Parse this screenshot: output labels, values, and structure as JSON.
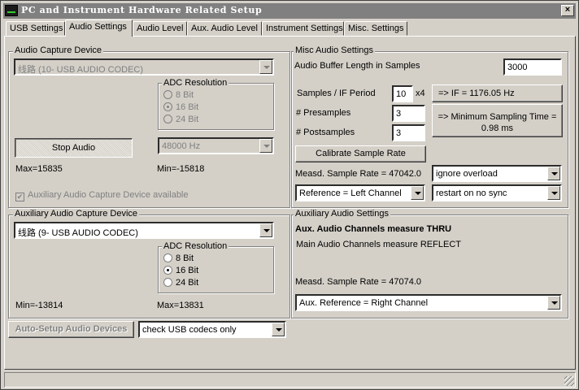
{
  "window": {
    "title": "PC and Instrument Hardware Related Setup",
    "close_label": "×"
  },
  "tabs": [
    {
      "label": "USB Settings"
    },
    {
      "label": "Audio Settings"
    },
    {
      "label": "Audio Level"
    },
    {
      "label": "Aux. Audio Level"
    },
    {
      "label": "Instrument Settings"
    },
    {
      "label": "Misc. Settings"
    }
  ],
  "capture": {
    "legend": "Audio Capture Device",
    "device": "线路 (10- USB AUDIO  CODEC)",
    "adc_legend": "ADC Resolution",
    "adc_options": [
      "8 Bit",
      "16 Bit",
      "24 Bit"
    ],
    "stop_button": "Stop Audio",
    "sample_rate": "48000 Hz",
    "max": "Max=15835",
    "min": "Min=-15818",
    "aux_available": "Auxiliary Audio Capture Device available"
  },
  "misc": {
    "legend": "Misc Audio Settings",
    "buffer_label": "Audio Buffer Length in Samples",
    "buffer_value": "3000",
    "spif_label": "Samples / IF Period",
    "spif_value": "10",
    "spif_suffix": "x4",
    "if_readout": "=> IF =    1176.05 Hz",
    "presamples_label": "# Presamples",
    "presamples_value": "3",
    "postsamples_label": "# Postsamples",
    "postsamples_value": "3",
    "min_sampling_line1": "=> Minimum Sampling Time =",
    "min_sampling_line2": "0.98 ms",
    "calibrate_button": "Calibrate Sample Rate",
    "measd_rate": "Measd. Sample Rate = 47042.0",
    "overload_select": "ignore overload",
    "reference_select": "Reference = Left Channel",
    "sync_select": "restart on no sync"
  },
  "aux_capture": {
    "legend": "Auxiliary Audio Capture Device",
    "device": "线路 (9- USB AUDIO  CODEC)",
    "adc_legend": "ADC Resolution",
    "adc_options": [
      "8 Bit",
      "16 Bit",
      "24 Bit"
    ],
    "min": "Min=-13814",
    "max": "Max=13831"
  },
  "aux_settings": {
    "legend": "Auxiliary Audio Settings",
    "channels_thru": "Aux. Audio Channels measure THRU",
    "channels_reflect": "Main Audio Channels measure REFLECT",
    "measd_rate": "Measd. Sample Rate = 47074.0",
    "reference_select": "Aux. Reference = Right Channel"
  },
  "bottom": {
    "auto_setup_button": "Auto-Setup Audio Devices",
    "usb_check_select": "check USB codecs only"
  }
}
